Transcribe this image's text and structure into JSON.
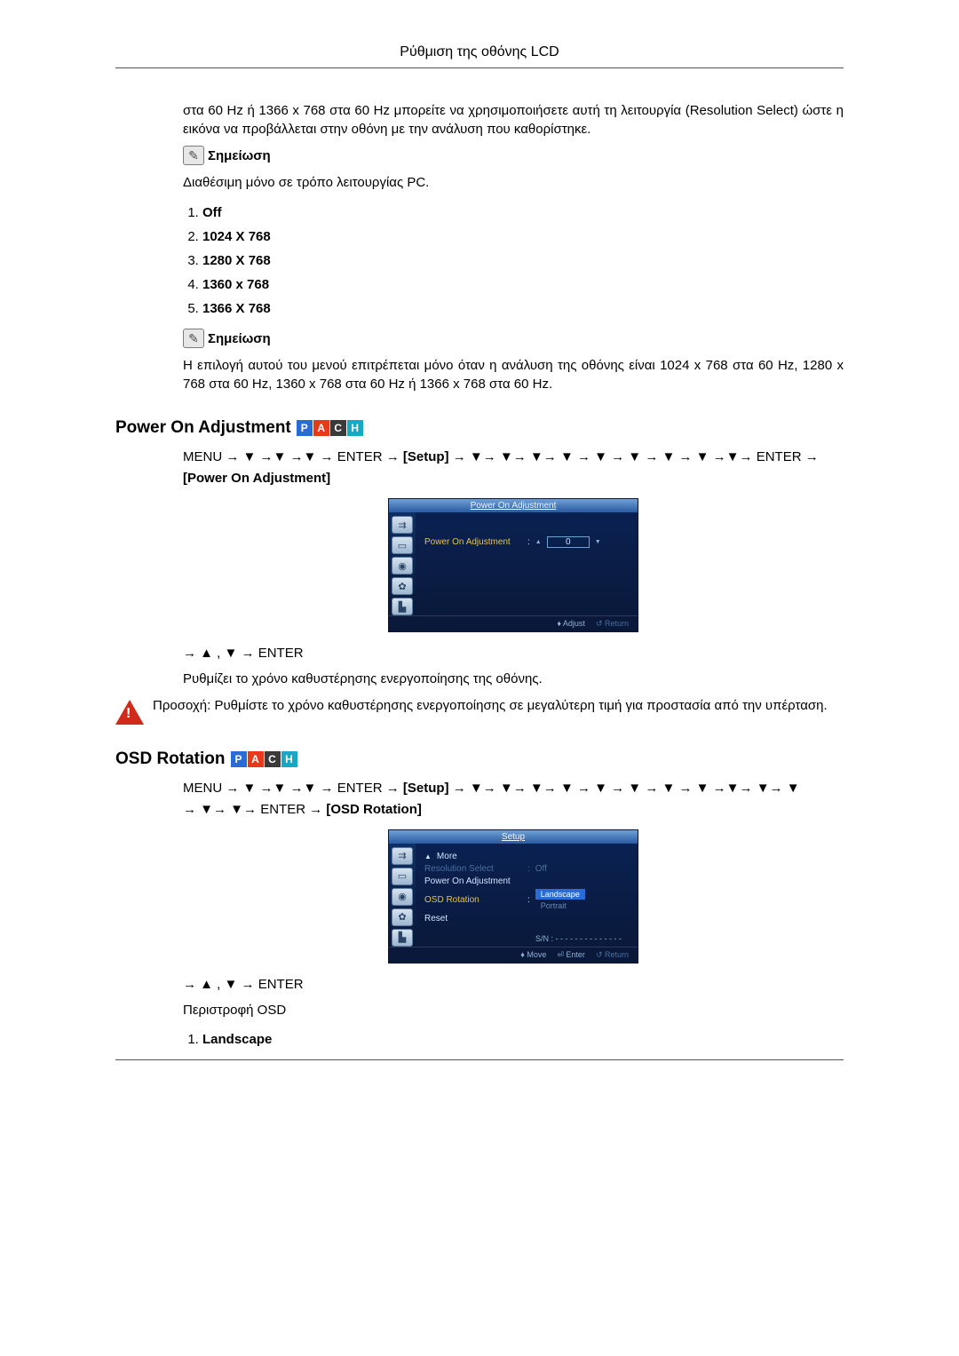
{
  "header": {
    "title": "Ρύθμιση της οθόνης LCD"
  },
  "intro": {
    "para1": "στα 60 Hz ή 1366 x 768 στα 60 Hz μπορείτε να χρησιμοποιήσετε αυτή τη λειτουργία (Resolution Select) ώστε η εικόνα να προβάλλεται στην οθόνη με την ανάλυση που καθορίστηκε."
  },
  "note_label": "Σημείωση",
  "pc_only": "Διαθέσιμη μόνο σε τρόπο λειτουργίας PC.",
  "res_list": {
    "i1": "Off",
    "i2": "1024 X 768",
    "i3": "1280 X 768",
    "i4": "1360 x 768",
    "i5": "1366 X 768"
  },
  "note2_body": "Η επιλογή αυτού του μενού επιτρέπεται μόνο όταν η ανάλυση της οθόνης είναι 1024 x 768 στα 60 Hz, 1280 x 768 στα 60 Hz, 1360 x 768 στα 60 Hz ή 1366 x 768 στα 60 Hz.",
  "badges": {
    "p": "P",
    "a": "A",
    "c": "C",
    "h": "H"
  },
  "power_on": {
    "heading": "Power On Adjustment",
    "path_pre": "MENU → ▼ →▼ →▼ → ENTER → ",
    "path_setup": "[Setup]",
    "path_mid": " → ▼→ ▼→ ▼→ ▼ → ▼ → ▼ → ▼ → ▼ →▼→ ENTER → ",
    "path_item": "[Power On Adjustment]",
    "osd": {
      "title": "Power On Adjustment",
      "label": "Power On Adjustment",
      "value": "0",
      "footer_adjust": "♦ Adjust",
      "footer_return": "↺ Return"
    },
    "after1": "→ ▲ , ▼ → ENTER",
    "desc": "Ρυθμίζει το χρόνο καθυστέρησης ενεργοποίησης της οθόνης.",
    "warn": "Προσοχή: Ρυθμίστε το χρόνο καθυστέρησης ενεργοποίησης σε μεγαλύτερη τιμή για προστασία από την υπέρταση."
  },
  "osd_rot": {
    "heading": "OSD Rotation",
    "path_line1": "MENU → ▼ →▼ →▼ → ENTER → ",
    "path_setup": "[Setup]",
    "path_line1b": " → ▼→ ▼→ ▼→ ▼ → ▼ → ▼ → ▼ → ▼ →▼→ ▼→ ▼",
    "path_line2": "→ ▼→ ▼→ ENTER → ",
    "path_item": "[OSD Rotation]",
    "osd": {
      "title": "Setup",
      "more": "More",
      "row_res": "Resolution Select",
      "row_res_val": "Off",
      "row_poa": "Power On Adjustment",
      "row_osdrot": "OSD Rotation",
      "opt_land": "Landscape",
      "opt_port": "Portrait",
      "row_reset": "Reset",
      "sn": "S/N : - - - - - - - - - - - - - -",
      "footer_move": "♦ Move",
      "footer_enter": "⏎ Enter",
      "footer_return": "↺ Return"
    },
    "after1": "→ ▲ , ▼ → ENTER",
    "desc": "Περιστροφή OSD",
    "li1": "Landscape"
  }
}
